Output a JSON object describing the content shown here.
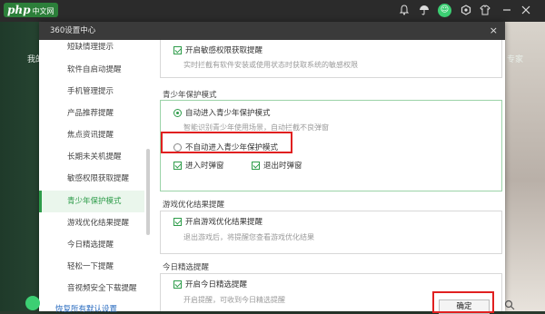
{
  "topbar": {
    "logo_text": "php",
    "logo_sub": "中文网",
    "icons": [
      "bell-icon",
      "umbrella-icon",
      "avatar-icon",
      "settings-icon",
      "skin-icon",
      "minimize-icon",
      "close-icon"
    ]
  },
  "background": {
    "left_text": "我的",
    "right_text": "专家"
  },
  "dialog": {
    "title": "360设置中心",
    "close": "×",
    "ok_label": "确定",
    "footer_link": "恢复所有默认设置"
  },
  "sidebar": {
    "items": [
      {
        "label": "短缺情理提示"
      },
      {
        "label": "软件自启动提醒"
      },
      {
        "label": "手机管理提示"
      },
      {
        "label": "产品推荐提醒"
      },
      {
        "label": "焦点资讯提醒"
      },
      {
        "label": "长期未关机提醒"
      },
      {
        "label": "敏感权限获取提醒"
      },
      {
        "label": "青少年保护模式",
        "active": true
      },
      {
        "label": "游戏优化结果提醒"
      },
      {
        "label": "今日精选提醒"
      },
      {
        "label": "轻松一下提醒"
      },
      {
        "label": "音视频安全下载提醒"
      }
    ]
  },
  "content": {
    "sensitive": {
      "checkbox_label": "开启敏感权限获取提醒",
      "desc": "实时拦截有软件安装或使用状态时获取系统的敏感权限"
    },
    "youth": {
      "section_title": "青少年保护模式",
      "radio_auto_label": "自动进入青少年保护模式",
      "radio_auto_desc": "智能识别青少年使用场景，自动拦截不良弹窗",
      "radio_manual_label": "不自动进入青少年保护模式",
      "enter_popup_label": "进入时弹窗",
      "exit_popup_label": "退出时弹窗"
    },
    "game": {
      "section_title": "游戏优化结果提醒",
      "checkbox_label": "开启游戏优化结果提醒",
      "desc": "退出游戏后，将提醒您查看游戏优化结果"
    },
    "daily": {
      "section_title": "今日精选提醒",
      "checkbox_label": "开启今日精选提醒",
      "desc": "开启提醒，可收到今日精选提醒"
    }
  },
  "colors": {
    "accent": "#2e9c4a",
    "highlight": "#e02020",
    "title_bar": "#3a3a3a"
  }
}
